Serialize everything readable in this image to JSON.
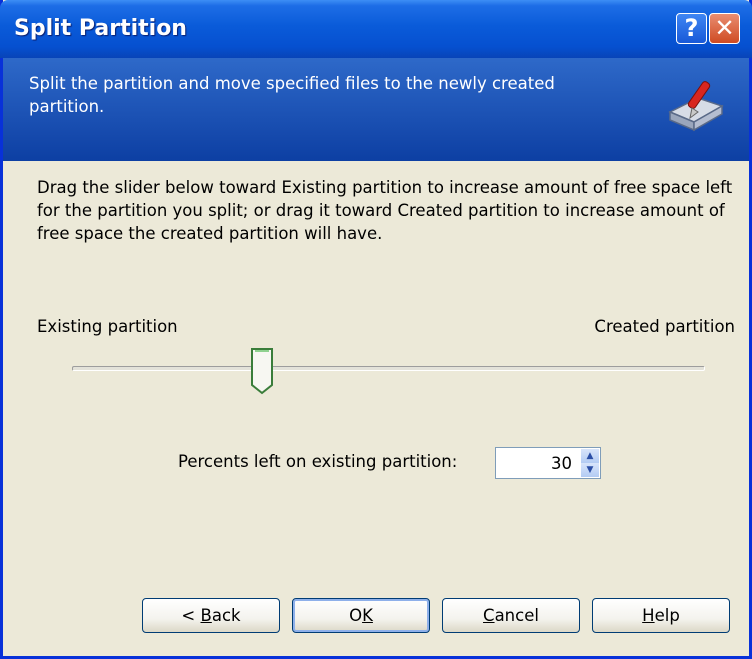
{
  "window": {
    "title": "Split Partition",
    "help_glyph": "?",
    "close_glyph": "✕"
  },
  "header": {
    "text": "Split the partition and move specified files to the newly created partition.",
    "icon": "disk-split-icon"
  },
  "body": {
    "description": "Drag the slider below toward Existing partition to increase amount of free space left for the partition you split; or drag it toward Created partition to increase amount of free space the created partition will have.",
    "slider": {
      "left_label": "Existing partition",
      "right_label": "Created partition",
      "value_percent": 30
    },
    "percent": {
      "label": "Percents left on existing partition:",
      "value": "30"
    }
  },
  "buttons": {
    "back": {
      "prefix": "< ",
      "accel": "B",
      "rest": "ack"
    },
    "ok": {
      "prefix": "O",
      "accel": "K",
      "rest": ""
    },
    "cancel": {
      "prefix": "",
      "accel": "C",
      "rest": "ancel"
    },
    "help": {
      "prefix": "",
      "accel": "H",
      "rest": "elp"
    }
  }
}
